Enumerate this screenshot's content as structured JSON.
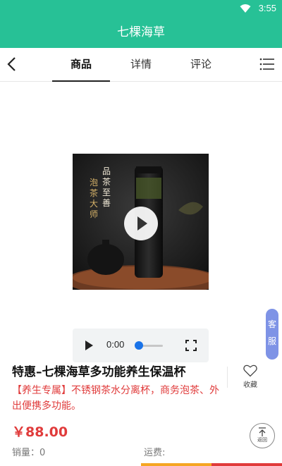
{
  "status_bar": {
    "time": "3:55"
  },
  "app_title": "七棵海草",
  "tabs": [
    {
      "label": "商品",
      "active": true
    },
    {
      "label": "详情",
      "active": false
    },
    {
      "label": "评论",
      "active": false
    }
  ],
  "media": {
    "poster_text_right": "品茶至善",
    "poster_text_left": "泡茶大师",
    "player_time": "0:00",
    "progress": 0
  },
  "customer_service": {
    "label_1": "客",
    "label_2": "服"
  },
  "product": {
    "title": "特惠–七棵海草多功能养生保温杯",
    "subtitle": "【养生专属】不锈钢茶水分离杯，商务泡茶、外出便携多功能。",
    "price": "￥88.00",
    "sales_label": "销量：0",
    "freight_label": "运费:"
  },
  "favorite": {
    "label": "收藏"
  },
  "back_to_top": {
    "label": "返回"
  },
  "colors": {
    "brand": "#27c196",
    "price": "#e03b3b",
    "service": "#7e93e6"
  }
}
